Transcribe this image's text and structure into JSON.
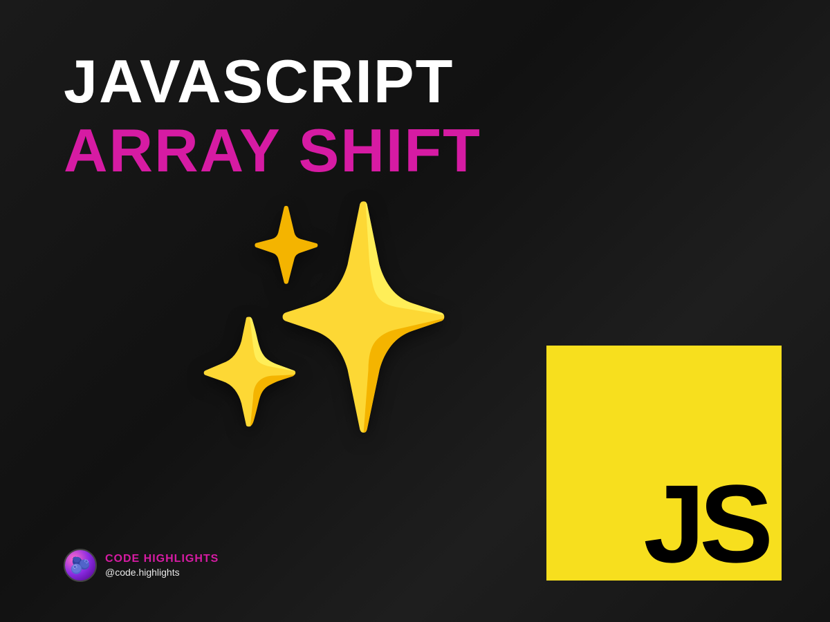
{
  "title": {
    "line1": "JAVASCRIPT",
    "line2": "ARRAY SHIFT"
  },
  "sparkles_emoji": "✨",
  "js_badge": {
    "text": "JS",
    "background_color": "#f7df1e",
    "text_color": "#000000"
  },
  "brand": {
    "name": "CODE HIGHLIGHTS",
    "handle": "@code.highlights",
    "accent_color": "#d61ba3"
  }
}
